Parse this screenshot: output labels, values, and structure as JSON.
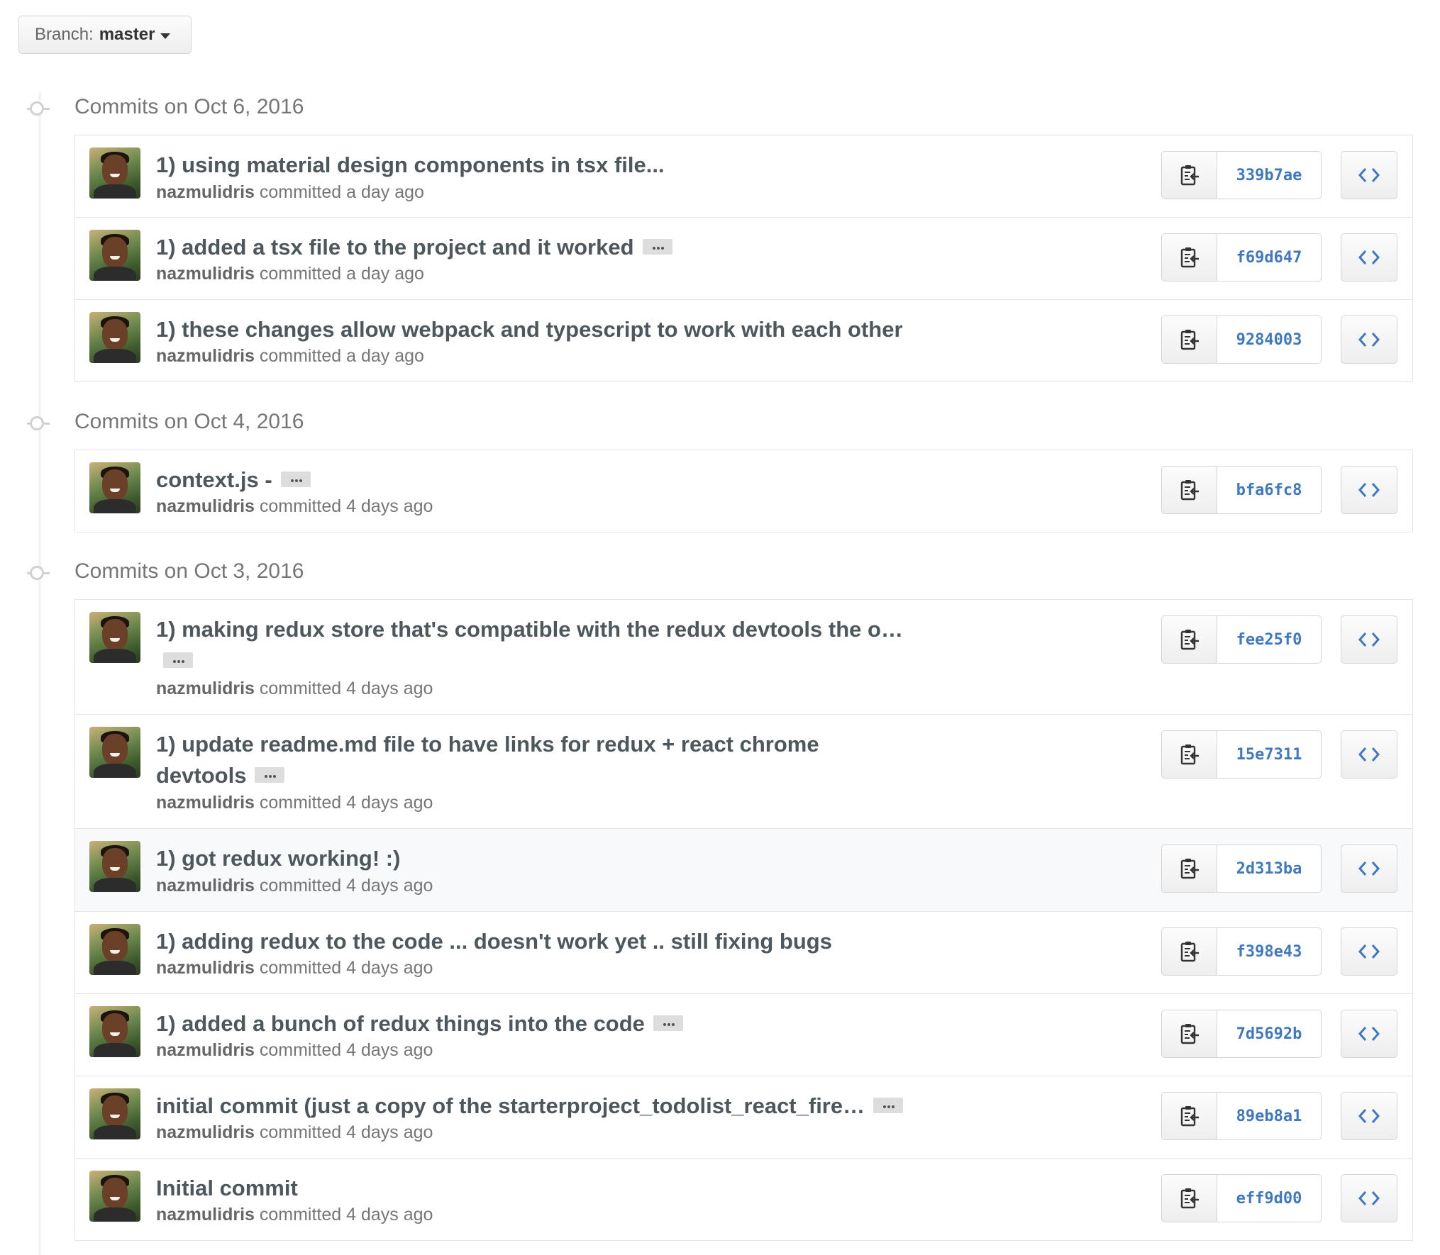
{
  "branch": {
    "prefix": "Branch:",
    "name": "master"
  },
  "groups": [
    {
      "title": "Commits on Oct 6, 2016",
      "commits": [
        {
          "message": "1) using material design components in tsx file...",
          "has_ellipsis": false,
          "author": "nazmulidris",
          "committed": "committed a day ago",
          "sha": "339b7ae"
        },
        {
          "message": "1) added a tsx file to the project and it worked",
          "has_ellipsis": true,
          "author": "nazmulidris",
          "committed": "committed a day ago",
          "sha": "f69d647"
        },
        {
          "message": "1) these changes allow webpack and typescript to work with each other",
          "has_ellipsis": false,
          "author": "nazmulidris",
          "committed": "committed a day ago",
          "sha": "9284003"
        }
      ]
    },
    {
      "title": "Commits on Oct 4, 2016",
      "commits": [
        {
          "message": "context.js -",
          "has_ellipsis": true,
          "author": "nazmulidris",
          "committed": "committed 4 days ago",
          "sha": "bfa6fc8"
        }
      ]
    },
    {
      "title": "Commits on Oct 3, 2016",
      "commits": [
        {
          "message": "1) making redux store that's compatible with the redux devtools the o…",
          "has_ellipsis": true,
          "author": "nazmulidris",
          "committed": "committed 4 days ago",
          "sha": "fee25f0"
        },
        {
          "message": "1) update readme.md file to have links for redux + react chrome devtools",
          "has_ellipsis": true,
          "author": "nazmulidris",
          "committed": "committed 4 days ago",
          "sha": "15e7311"
        },
        {
          "message": "1) got redux working! :)",
          "has_ellipsis": false,
          "author": "nazmulidris",
          "committed": "committed 4 days ago",
          "sha": "2d313ba"
        },
        {
          "message": "1) adding redux to the code ... doesn't work yet .. still fixing bugs",
          "has_ellipsis": false,
          "author": "nazmulidris",
          "committed": "committed 4 days ago",
          "sha": "f398e43"
        },
        {
          "message": "1) added a bunch of redux things into the code",
          "has_ellipsis": true,
          "author": "nazmulidris",
          "committed": "committed 4 days ago",
          "sha": "7d5692b"
        },
        {
          "message": "initial commit (just a copy of the starterproject_todolist_react_fire…",
          "has_ellipsis": true,
          "author": "nazmulidris",
          "committed": "committed 4 days ago",
          "sha": "89eb8a1"
        },
        {
          "message": "Initial commit",
          "has_ellipsis": false,
          "author": "nazmulidris",
          "committed": "committed 4 days ago",
          "sha": "eff9d00"
        }
      ]
    }
  ],
  "icons": {
    "copy": "clippy-icon",
    "browse": "code-icon"
  },
  "colors": {
    "sha": "#4078c0",
    "message": "#4e575b",
    "meta": "#767676",
    "border": "#e5e5e5",
    "highlight_row": "#f7f9fb"
  }
}
